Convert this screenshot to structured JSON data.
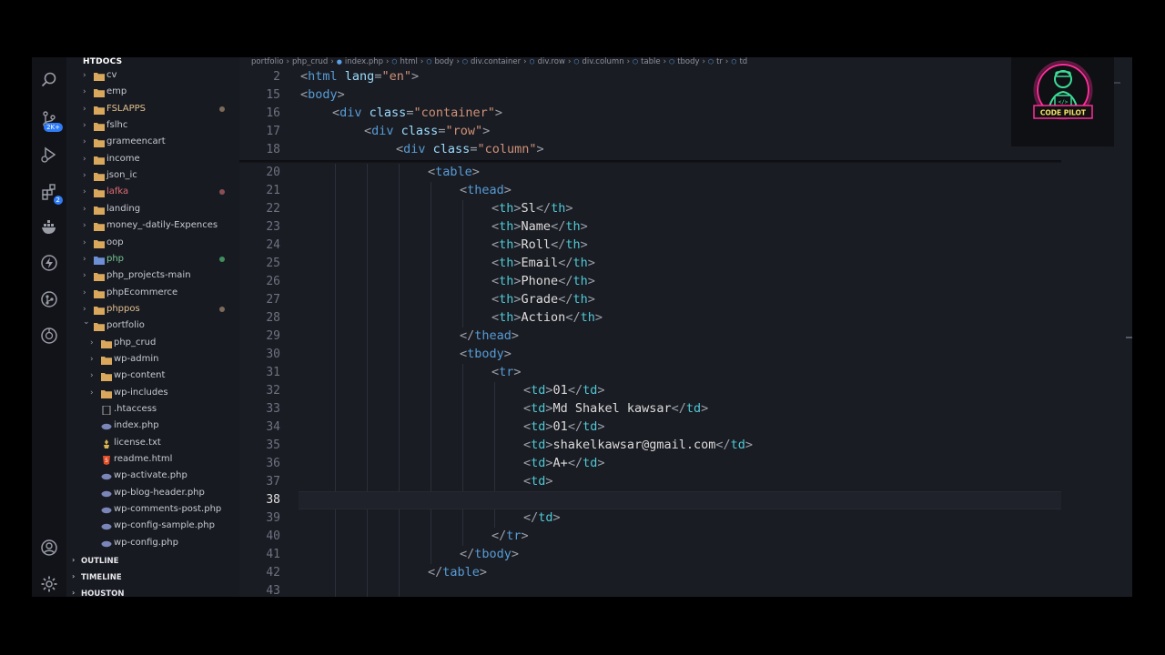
{
  "sidebar": {
    "root_label": "HTDOCS",
    "items": [
      {
        "label": "cv",
        "type": "folder",
        "depth": 0,
        "expanded": false,
        "color": "#c7c9d1",
        "dot": null
      },
      {
        "label": "emp",
        "type": "folder",
        "depth": 0,
        "expanded": false,
        "color": "#c7c9d1",
        "dot": null
      },
      {
        "label": "FSLAPPS",
        "type": "folder",
        "depth": 0,
        "expanded": false,
        "color": "#e2c08d",
        "dot": "#7c6a58"
      },
      {
        "label": "fslhc",
        "type": "folder",
        "depth": 0,
        "expanded": false,
        "color": "#c7c9d1",
        "dot": null
      },
      {
        "label": "grameencart",
        "type": "folder",
        "depth": 0,
        "expanded": false,
        "color": "#c7c9d1",
        "dot": null
      },
      {
        "label": "income",
        "type": "folder",
        "depth": 0,
        "expanded": false,
        "color": "#c7c9d1",
        "dot": null
      },
      {
        "label": "json_ic",
        "type": "folder",
        "depth": 0,
        "expanded": false,
        "color": "#c7c9d1",
        "dot": null
      },
      {
        "label": "lafka",
        "type": "folder",
        "depth": 0,
        "expanded": false,
        "color": "#e06c75",
        "dot": "#8a4f55"
      },
      {
        "label": "landing",
        "type": "folder",
        "depth": 0,
        "expanded": false,
        "color": "#c7c9d1",
        "dot": null
      },
      {
        "label": "money_-datily-Expences",
        "type": "folder",
        "depth": 0,
        "expanded": false,
        "color": "#c7c9d1",
        "dot": null
      },
      {
        "label": "oop",
        "type": "folder",
        "depth": 0,
        "expanded": false,
        "color": "#c7c9d1",
        "dot": null
      },
      {
        "label": "php",
        "type": "folder-blue",
        "depth": 0,
        "expanded": false,
        "color": "#73c991",
        "dot": "#3f8f5e"
      },
      {
        "label": "php_projects-main",
        "type": "folder",
        "depth": 0,
        "expanded": false,
        "color": "#c7c9d1",
        "dot": null
      },
      {
        "label": "phpEcommerce",
        "type": "folder",
        "depth": 0,
        "expanded": false,
        "color": "#c7c9d1",
        "dot": null
      },
      {
        "label": "phppos",
        "type": "folder",
        "depth": 0,
        "expanded": false,
        "color": "#e2c08d",
        "dot": "#7c6a58"
      },
      {
        "label": "portfolio",
        "type": "folder",
        "depth": 0,
        "expanded": true,
        "color": "#c7c9d1",
        "dot": null
      },
      {
        "label": "php_crud",
        "type": "folder",
        "depth": 1,
        "expanded": false,
        "color": "#c7c9d1",
        "dot": null
      },
      {
        "label": "wp-admin",
        "type": "folder",
        "depth": 1,
        "expanded": false,
        "color": "#c7c9d1",
        "dot": null
      },
      {
        "label": "wp-content",
        "type": "folder",
        "depth": 1,
        "expanded": false,
        "color": "#c7c9d1",
        "dot": null
      },
      {
        "label": "wp-includes",
        "type": "folder",
        "depth": 1,
        "expanded": false,
        "color": "#c7c9d1",
        "dot": null
      },
      {
        "label": ".htaccess",
        "type": "file-plain",
        "depth": 1,
        "expanded": false,
        "color": "#c7c9d1",
        "dot": null
      },
      {
        "label": "index.php",
        "type": "file-php",
        "depth": 1,
        "expanded": false,
        "color": "#c7c9d1",
        "dot": null
      },
      {
        "label": "license.txt",
        "type": "file-license",
        "depth": 1,
        "expanded": false,
        "color": "#c7c9d1",
        "dot": null
      },
      {
        "label": "readme.html",
        "type": "file-html",
        "depth": 1,
        "expanded": false,
        "color": "#c7c9d1",
        "dot": null
      },
      {
        "label": "wp-activate.php",
        "type": "file-php",
        "depth": 1,
        "expanded": false,
        "color": "#c7c9d1",
        "dot": null
      },
      {
        "label": "wp-blog-header.php",
        "type": "file-php",
        "depth": 1,
        "expanded": false,
        "color": "#c7c9d1",
        "dot": null
      },
      {
        "label": "wp-comments-post.php",
        "type": "file-php",
        "depth": 1,
        "expanded": false,
        "color": "#c7c9d1",
        "dot": null
      },
      {
        "label": "wp-config-sample.php",
        "type": "file-php",
        "depth": 1,
        "expanded": false,
        "color": "#c7c9d1",
        "dot": null
      },
      {
        "label": "wp-config.php",
        "type": "file-php",
        "depth": 1,
        "expanded": false,
        "color": "#c7c9d1",
        "dot": null
      }
    ],
    "sections": [
      "OUTLINE",
      "TIMELINE",
      "HOUSTON"
    ]
  },
  "activity_bar": {
    "top": [
      {
        "name": "search-icon"
      },
      {
        "name": "source-control-icon",
        "badge": "2K+"
      },
      {
        "name": "run-debug-icon"
      },
      {
        "name": "extensions-icon",
        "badge": "2"
      },
      {
        "name": "docker-icon"
      },
      {
        "name": "thunder-client-icon"
      },
      {
        "name": "gitlens-icon"
      },
      {
        "name": "remote-explorer-icon"
      }
    ],
    "bottom": [
      {
        "name": "account-icon"
      },
      {
        "name": "settings-gear-icon"
      }
    ]
  },
  "breadcrumb": [
    "portfolio",
    "php_crud",
    "index.php",
    "html",
    "body",
    "div.container",
    "div.row",
    "div.column",
    "table",
    "tbody",
    "tr",
    "td"
  ],
  "sticky_lines": [
    {
      "ln": "2",
      "indent": 0,
      "tokens": [
        [
          "p",
          "<"
        ],
        [
          "t",
          "html"
        ],
        [
          "x",
          " "
        ],
        [
          "a",
          "lang"
        ],
        [
          "p",
          "="
        ],
        [
          "s",
          "\"en\""
        ],
        [
          "p",
          ">"
        ]
      ]
    },
    {
      "ln": "15",
      "indent": 0,
      "tokens": [
        [
          "p",
          "<"
        ],
        [
          "t",
          "body"
        ],
        [
          "p",
          ">"
        ]
      ]
    },
    {
      "ln": "16",
      "indent": 1,
      "tokens": [
        [
          "p",
          "<"
        ],
        [
          "t",
          "div"
        ],
        [
          "x",
          " "
        ],
        [
          "a",
          "class"
        ],
        [
          "p",
          "="
        ],
        [
          "s",
          "\"container\""
        ],
        [
          "p",
          ">"
        ]
      ]
    },
    {
      "ln": "17",
      "indent": 2,
      "tokens": [
        [
          "p",
          "<"
        ],
        [
          "t",
          "div"
        ],
        [
          "x",
          " "
        ],
        [
          "a",
          "class"
        ],
        [
          "p",
          "="
        ],
        [
          "s",
          "\"row\""
        ],
        [
          "p",
          ">"
        ]
      ]
    },
    {
      "ln": "18",
      "indent": 3,
      "tokens": [
        [
          "p",
          "<"
        ],
        [
          "t",
          "div"
        ],
        [
          "x",
          " "
        ],
        [
          "a",
          "class"
        ],
        [
          "p",
          "="
        ],
        [
          "s",
          "\"column\""
        ],
        [
          "p",
          ">"
        ]
      ]
    }
  ],
  "code_lines": [
    {
      "ln": "20",
      "indent": 4,
      "tokens": [
        [
          "p",
          "<"
        ],
        [
          "t",
          "table"
        ],
        [
          "p",
          ">"
        ]
      ]
    },
    {
      "ln": "21",
      "indent": 5,
      "tokens": [
        [
          "p",
          "<"
        ],
        [
          "t",
          "thead"
        ],
        [
          "p",
          ">"
        ]
      ]
    },
    {
      "ln": "22",
      "indent": 6,
      "tokens": [
        [
          "p",
          "<"
        ],
        [
          "tc",
          "th"
        ],
        [
          "p",
          ">"
        ],
        [
          "x",
          "Sl"
        ],
        [
          "p",
          "</"
        ],
        [
          "tc",
          "th"
        ],
        [
          "p",
          ">"
        ]
      ]
    },
    {
      "ln": "23",
      "indent": 6,
      "tokens": [
        [
          "p",
          "<"
        ],
        [
          "tc",
          "th"
        ],
        [
          "p",
          ">"
        ],
        [
          "x",
          "Name"
        ],
        [
          "p",
          "</"
        ],
        [
          "tc",
          "th"
        ],
        [
          "p",
          ">"
        ]
      ]
    },
    {
      "ln": "24",
      "indent": 6,
      "tokens": [
        [
          "p",
          "<"
        ],
        [
          "tc",
          "th"
        ],
        [
          "p",
          ">"
        ],
        [
          "x",
          "Roll"
        ],
        [
          "p",
          "</"
        ],
        [
          "tc",
          "th"
        ],
        [
          "p",
          ">"
        ]
      ]
    },
    {
      "ln": "25",
      "indent": 6,
      "tokens": [
        [
          "p",
          "<"
        ],
        [
          "tc",
          "th"
        ],
        [
          "p",
          ">"
        ],
        [
          "x",
          "Email"
        ],
        [
          "p",
          "</"
        ],
        [
          "tc",
          "th"
        ],
        [
          "p",
          ">"
        ]
      ]
    },
    {
      "ln": "26",
      "indent": 6,
      "tokens": [
        [
          "p",
          "<"
        ],
        [
          "tc",
          "th"
        ],
        [
          "p",
          ">"
        ],
        [
          "x",
          "Phone"
        ],
        [
          "p",
          "</"
        ],
        [
          "tc",
          "th"
        ],
        [
          "p",
          ">"
        ]
      ]
    },
    {
      "ln": "27",
      "indent": 6,
      "tokens": [
        [
          "p",
          "<"
        ],
        [
          "tc",
          "th"
        ],
        [
          "p",
          ">"
        ],
        [
          "x",
          "Grade"
        ],
        [
          "p",
          "</"
        ],
        [
          "tc",
          "th"
        ],
        [
          "p",
          ">"
        ]
      ]
    },
    {
      "ln": "28",
      "indent": 6,
      "tokens": [
        [
          "p",
          "<"
        ],
        [
          "tc",
          "th"
        ],
        [
          "p",
          ">"
        ],
        [
          "x",
          "Action"
        ],
        [
          "p",
          "</"
        ],
        [
          "tc",
          "th"
        ],
        [
          "p",
          ">"
        ]
      ]
    },
    {
      "ln": "29",
      "indent": 5,
      "tokens": [
        [
          "p",
          "</"
        ],
        [
          "t",
          "thead"
        ],
        [
          "p",
          ">"
        ]
      ]
    },
    {
      "ln": "30",
      "indent": 5,
      "tokens": [
        [
          "p",
          "<"
        ],
        [
          "t",
          "tbody"
        ],
        [
          "p",
          ">"
        ]
      ]
    },
    {
      "ln": "31",
      "indent": 6,
      "tokens": [
        [
          "p",
          "<"
        ],
        [
          "t",
          "tr"
        ],
        [
          "p",
          ">"
        ]
      ]
    },
    {
      "ln": "32",
      "indent": 7,
      "tokens": [
        [
          "p",
          "<"
        ],
        [
          "tc",
          "td"
        ],
        [
          "p",
          ">"
        ],
        [
          "x",
          "01"
        ],
        [
          "p",
          "</"
        ],
        [
          "tc",
          "td"
        ],
        [
          "p",
          ">"
        ]
      ]
    },
    {
      "ln": "33",
      "indent": 7,
      "tokens": [
        [
          "p",
          "<"
        ],
        [
          "tc",
          "td"
        ],
        [
          "p",
          ">"
        ],
        [
          "x",
          "Md Shakel kawsar"
        ],
        [
          "p",
          "</"
        ],
        [
          "tc",
          "td"
        ],
        [
          "p",
          ">"
        ]
      ]
    },
    {
      "ln": "34",
      "indent": 7,
      "tokens": [
        [
          "p",
          "<"
        ],
        [
          "tc",
          "td"
        ],
        [
          "p",
          ">"
        ],
        [
          "x",
          "01"
        ],
        [
          "p",
          "</"
        ],
        [
          "tc",
          "td"
        ],
        [
          "p",
          ">"
        ]
      ]
    },
    {
      "ln": "35",
      "indent": 7,
      "tokens": [
        [
          "p",
          "<"
        ],
        [
          "tc",
          "td"
        ],
        [
          "p",
          ">"
        ],
        [
          "x",
          "shakelkawsar@gmail.com"
        ],
        [
          "p",
          "</"
        ],
        [
          "tc",
          "td"
        ],
        [
          "p",
          ">"
        ]
      ]
    },
    {
      "ln": "36",
      "indent": 7,
      "tokens": [
        [
          "p",
          "<"
        ],
        [
          "tc",
          "td"
        ],
        [
          "p",
          ">"
        ],
        [
          "x",
          "A+"
        ],
        [
          "p",
          "</"
        ],
        [
          "tc",
          "td"
        ],
        [
          "p",
          ">"
        ]
      ]
    },
    {
      "ln": "37",
      "indent": 7,
      "tokens": [
        [
          "p",
          "<"
        ],
        [
          "tc",
          "td"
        ],
        [
          "p",
          ">"
        ]
      ]
    },
    {
      "ln": "38",
      "indent": 0,
      "tokens": [],
      "active": true
    },
    {
      "ln": "39",
      "indent": 7,
      "tokens": [
        [
          "p",
          "</"
        ],
        [
          "tc",
          "td"
        ],
        [
          "p",
          ">"
        ]
      ]
    },
    {
      "ln": "40",
      "indent": 6,
      "tokens": [
        [
          "p",
          "</"
        ],
        [
          "t",
          "tr"
        ],
        [
          "p",
          ">"
        ]
      ]
    },
    {
      "ln": "41",
      "indent": 5,
      "tokens": [
        [
          "p",
          "</"
        ],
        [
          "t",
          "tbody"
        ],
        [
          "p",
          ">"
        ]
      ]
    },
    {
      "ln": "42",
      "indent": 4,
      "tokens": [
        [
          "p",
          "</"
        ],
        [
          "t",
          "table"
        ],
        [
          "p",
          ">"
        ]
      ]
    },
    {
      "ln": "43",
      "indent": 0,
      "tokens": []
    }
  ],
  "logo": {
    "text": "CODE PILOT",
    "accent": "#ff2d9a",
    "figure": "#3ddc97"
  },
  "colors": {
    "tag": "#569cd6",
    "attr": "#9cdcfe",
    "string": "#ce9178",
    "text": "#dcdcdc",
    "punct": "#9ba0aa"
  }
}
